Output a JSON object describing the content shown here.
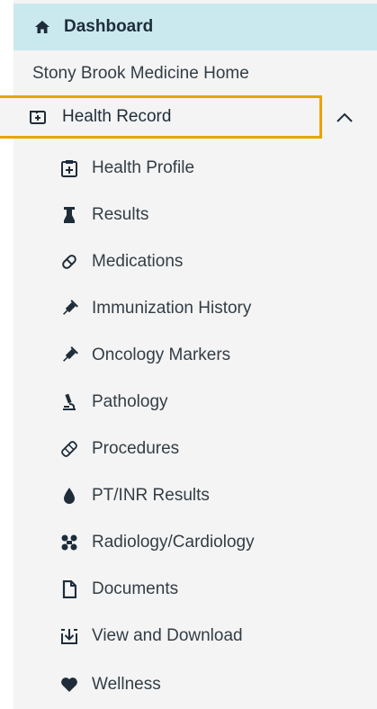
{
  "nav": {
    "dashboard": {
      "label": "Dashboard",
      "icon": "home-icon"
    },
    "home_link": "Stony Brook Medicine Home",
    "health_record": {
      "label": "Health Record",
      "icon": "health-record-icon",
      "expanded": true,
      "items": [
        {
          "label": "Health Profile",
          "icon": "health-profile-icon"
        },
        {
          "label": "Results",
          "icon": "results-icon"
        },
        {
          "label": "Medications",
          "icon": "pill-icon"
        },
        {
          "label": "Immunization History",
          "icon": "syringe-icon"
        },
        {
          "label": "Oncology Markers",
          "icon": "syringe-icon"
        },
        {
          "label": "Pathology",
          "icon": "microscope-icon"
        },
        {
          "label": "Procedures",
          "icon": "bandage-icon"
        },
        {
          "label": "PT/INR Results",
          "icon": "drop-icon"
        },
        {
          "label": "Radiology/Cardiology",
          "icon": "radiology-icon"
        },
        {
          "label": "Documents",
          "icon": "document-icon"
        },
        {
          "label": "View and Download",
          "icon": "download-icon"
        },
        {
          "label": "Wellness",
          "icon": "heart-icon"
        }
      ]
    }
  },
  "colors": {
    "highlight_border": "#e7a400",
    "dashboard_bg": "#c9e9ee",
    "sidebar_bg": "#f4f4f4"
  }
}
